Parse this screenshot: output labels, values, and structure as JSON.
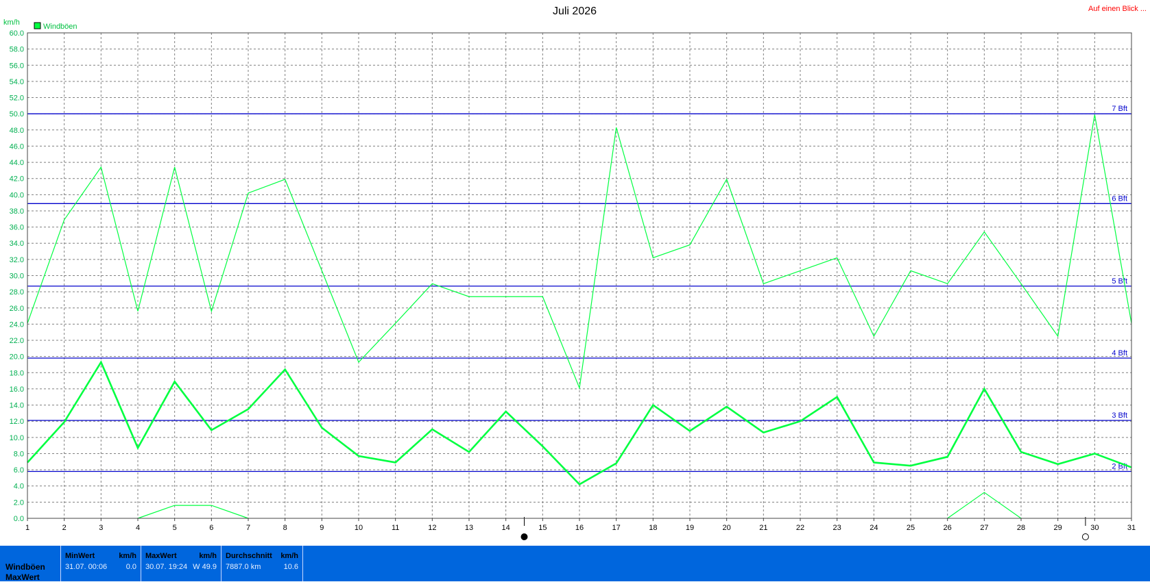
{
  "header": {
    "title": "Juli 2026",
    "link": "Auf einen Blick ..."
  },
  "colors": {
    "series": "#00ff40",
    "bft_line": "#0000cc",
    "grid": "#7f7f7f",
    "stats_bg": "#0066dd"
  },
  "chart_data": {
    "type": "line",
    "title": "Juli 2026",
    "ylabel": "km/h",
    "xlabel": "",
    "ylim": [
      0,
      60
    ],
    "y_ticks": [
      "0.0",
      "2.0",
      "4.0",
      "6.0",
      "8.0",
      "10.0",
      "12.0",
      "14.0",
      "16.0",
      "18.0",
      "20.0",
      "22.0",
      "24.0",
      "26.0",
      "28.0",
      "30.0",
      "32.0",
      "34.0",
      "36.0",
      "38.0",
      "40.0",
      "42.0",
      "44.0",
      "46.0",
      "48.0",
      "50.0",
      "52.0",
      "54.0",
      "56.0",
      "58.0",
      "60.0"
    ],
    "x": [
      1,
      2,
      3,
      4,
      5,
      6,
      7,
      8,
      9,
      10,
      11,
      12,
      13,
      14,
      15,
      16,
      17,
      18,
      19,
      20,
      21,
      22,
      23,
      24,
      25,
      26,
      27,
      28,
      29,
      30,
      31
    ],
    "legend": [
      {
        "name": "Windböen",
        "color": "#00ff40",
        "position": "top-left"
      }
    ],
    "series": [
      {
        "role": "max",
        "values": [
          24.1,
          36.9,
          43.4,
          25.6,
          43.4,
          25.6,
          40.2,
          41.9,
          30.6,
          19.3,
          24.1,
          29.0,
          27.4,
          27.4,
          27.4,
          16.1,
          48.3,
          32.2,
          33.8,
          41.9,
          29.0,
          30.6,
          32.2,
          22.5,
          30.6,
          29.0,
          35.4,
          29.0,
          22.5,
          49.9,
          24.1
        ]
      },
      {
        "role": "average",
        "values": [
          6.9,
          11.9,
          19.3,
          8.7,
          16.9,
          10.9,
          13.5,
          18.4,
          11.2,
          7.7,
          6.9,
          11.0,
          8.2,
          13.2,
          8.9,
          4.2,
          6.8,
          14.0,
          10.8,
          13.8,
          10.6,
          12.0,
          15.0,
          6.9,
          6.5,
          7.6,
          16.0,
          8.2,
          6.7,
          8.0,
          6.3
        ]
      },
      {
        "role": "min",
        "segments": [
          {
            "x": [
              4,
              5,
              6,
              7
            ],
            "values": [
              0.0,
              1.6,
              1.6,
              0.0
            ]
          },
          {
            "x": [
              26,
              27,
              28
            ],
            "values": [
              0.0,
              3.2,
              0.0
            ]
          }
        ]
      }
    ],
    "reference_lines": [
      {
        "label": "2 Bft",
        "value": 5.8
      },
      {
        "label": "3 Bft",
        "value": 12.1
      },
      {
        "label": "4 Bft",
        "value": 19.8
      },
      {
        "label": "5 Bft",
        "value": 28.7
      },
      {
        "label": "6 Bft",
        "value": 38.9
      },
      {
        "label": "7 Bft",
        "value": 50.0
      }
    ],
    "moon_markers": [
      {
        "x": 14.5,
        "phase": "new-moon"
      },
      {
        "x": 29.75,
        "phase": "full-moon"
      }
    ],
    "grid": true
  },
  "stats": {
    "row_labels": [
      "Windböen",
      "MaxWert"
    ],
    "min": {
      "header": "MinWert",
      "unit": "km/h",
      "when": "31.07.  00:06",
      "value": "0.0"
    },
    "max": {
      "header": "MaxWert",
      "unit": "km/h",
      "when": "30.07.  19:24",
      "value": "W 49.9"
    },
    "avg": {
      "header": "Durchschnitt",
      "unit": "km/h",
      "when": "7887.0 km",
      "value": "10.6"
    }
  }
}
